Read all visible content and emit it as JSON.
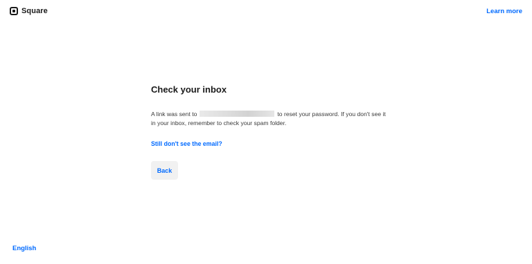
{
  "header": {
    "brand_name": "Square",
    "logo_icon": "square-logo-icon",
    "learn_more_label": "Learn more"
  },
  "main": {
    "title": "Check your inbox",
    "message_before": "A link was sent to",
    "message_after": "to reset your password. If you don't see it in your inbox, remember to check your spam folder.",
    "help_link_label": "Still don't see the email?",
    "back_label": "Back"
  },
  "footer": {
    "language_label": "English"
  },
  "colors": {
    "link": "#006aff",
    "text": "#1a1a1a",
    "button_bg": "#f1f1f1"
  }
}
